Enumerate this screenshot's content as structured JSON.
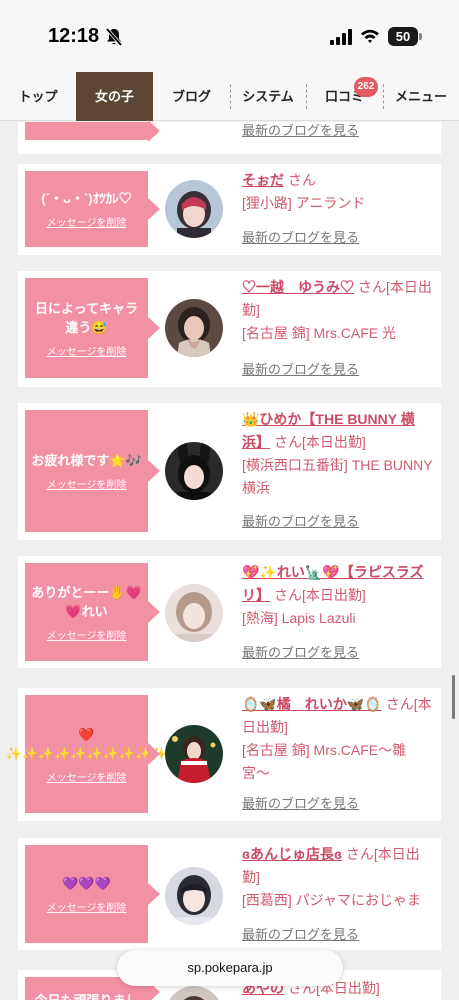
{
  "status_bar": {
    "time": "12:18",
    "battery": "50"
  },
  "nav": {
    "tabs": [
      {
        "label": "トップ"
      },
      {
        "label": "女の子"
      },
      {
        "label": "ブログ"
      },
      {
        "label": "システム"
      },
      {
        "label": "口コミ"
      },
      {
        "label": "メニュー"
      }
    ],
    "active_index": 1,
    "review_badge": "262"
  },
  "common": {
    "delete_label": "メッセージを削除",
    "blog_label": "最新のブログを見る",
    "san": "さん",
    "working_today": "[本日出勤]"
  },
  "cards": [
    {
      "message": "",
      "name": "",
      "shop": ""
    },
    {
      "message": "(´・ᴗ・`)ｵﾂｶﾚ♡",
      "name": "そぉだ",
      "status": "",
      "shop": "[狸小路] アニランド"
    },
    {
      "message": "日によってキャラ違う😅",
      "name": "♡一越　ゆうみ♡",
      "status": "[本日出勤]",
      "shop": "[名古屋 錦] Mrs.CAFE 光"
    },
    {
      "message": "お疲れ様です🌟🎶",
      "name": "👑ひめか【THE BUNNY 横浜】",
      "status": "[本日出勤]",
      "shop": "[横浜西口五番街] THE BUNNY横浜"
    },
    {
      "message": "ありがとーー✋💗💗れい",
      "name": "💖✨れい🗽💖【ラピスラズリ】",
      "status": "[本日出勤]",
      "shop": "[熱海] Lapis Lazuli"
    },
    {
      "message": "❤️✨✨✨✨✨✨✨✨✨✨",
      "name": "🪞🦋橘　れいか🦋🪞",
      "status": "[本日出勤]",
      "shop": "[名古屋 錦] Mrs.CAFE〜雛宮〜"
    },
    {
      "message": "💜💜💜",
      "name": "ɞあんじゅ店長ɞ",
      "status": "[本日出勤]",
      "shop": "[西葛西] パジャマにおじゃま"
    },
    {
      "message": "今日も頑張りまし",
      "name": "あやの",
      "status": "[本日出勤]",
      "shop": ""
    }
  ],
  "url_bar": {
    "domain": "sp.pokepara.jp"
  },
  "colors": {
    "accent": "#d25a6e",
    "message_bg": "#f391a4",
    "active_tab": "#5e4634"
  }
}
